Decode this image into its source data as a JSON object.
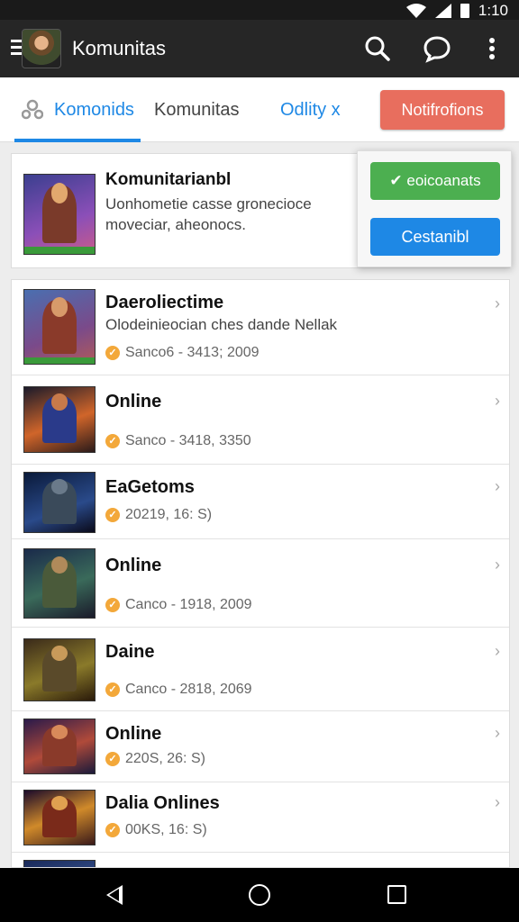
{
  "status_bar": {
    "time": "1:10"
  },
  "app_bar": {
    "title": "Komunitas"
  },
  "tabs": [
    {
      "label": "Komonids",
      "active": true
    },
    {
      "label": "Komunitas",
      "active": false
    },
    {
      "label": "Odlity x",
      "active": false
    }
  ],
  "notifications_button": "Notifrofions",
  "featured": {
    "title": "Komunitarianbl",
    "description": "Uonhometie casse gronecioce moveciar, aheonocs.",
    "primary_button": "eoicoanats",
    "secondary_button": "Cestanibl"
  },
  "list": [
    {
      "title": "Daeroliectime",
      "subtitle": "Olodeinieocian ches dande Nellak",
      "meta": "Sanco6 - 3413; 2009"
    },
    {
      "title": "Online",
      "subtitle": "",
      "meta": "Sanco - 3418, 3350"
    },
    {
      "title": "EaGetoms",
      "subtitle": "",
      "meta": "20219, 16: S)"
    },
    {
      "title": "Online",
      "subtitle": "",
      "meta": "Canco - 1918, 2009"
    },
    {
      "title": "Daine",
      "subtitle": "",
      "meta": "Canco - 2818, 2069"
    },
    {
      "title": "Online",
      "subtitle": "",
      "meta": "220S, 26: S)"
    },
    {
      "title": "Dalia Onlines",
      "subtitle": "",
      "meta": "00KS, 16: S)"
    }
  ],
  "colors": {
    "accent_blue": "#1e88e5",
    "notification_red": "#e86e5e",
    "confirm_green": "#4caf50",
    "coin_orange": "#f3a83a"
  },
  "icons": [
    "wifi-icon",
    "signal-icon",
    "battery-icon",
    "menu-icon",
    "search-icon",
    "chat-icon",
    "more-vert-icon",
    "community-icon",
    "check-icon",
    "coin-icon",
    "chevron-right-icon",
    "back-icon",
    "home-icon",
    "recents-icon"
  ]
}
